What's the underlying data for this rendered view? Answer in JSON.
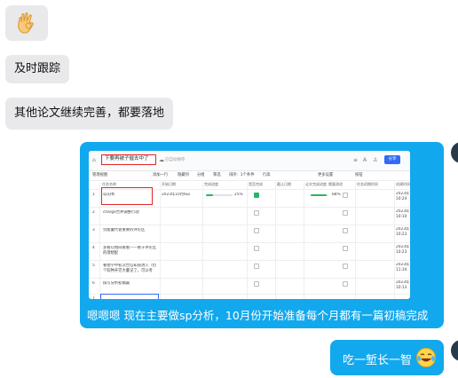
{
  "messages": {
    "incoming": [
      {
        "type": "emoji",
        "emoji": "ok-hand"
      },
      {
        "type": "text",
        "text": "及时跟踪"
      },
      {
        "type": "text",
        "text": "其他论文继续完善，都要落地"
      }
    ],
    "outgoing_caption": "嗯嗯嗯 现在主要做sp分析，10月份开始准备每个月都有一篇初稿完成",
    "outgoing_reply": "吃一堑长一智",
    "reply_emoji": "laughing-tears-face"
  },
  "embedded_screenshot": {
    "doc_title": "下要再被子催去中了",
    "saved_status": "已自动保存",
    "share_label": "分享",
    "toolbar": [
      "管理视图",
      "添加一行",
      "隐藏列",
      "分组",
      "筛选",
      "排序：1个条件",
      "行高",
      "更多设置",
      "按钮"
    ],
    "columns": [
      "任务名称",
      "开始日期",
      "完成进度",
      "是否完成",
      "截止日期",
      "论文完成进度",
      "需要改进",
      "任务初期时间",
      "创建时间"
    ],
    "rows": [
      {
        "num": "1",
        "task": "sp分析",
        "start": "2023年10月6日",
        "progress_pct": 25,
        "progress_label": "25%",
        "done": true,
        "paper_pct": 88,
        "paper_label": "88%",
        "created": "2023年\n10:24"
      },
      {
        "num": "2",
        "task": "charge合并调整行动",
        "start": "",
        "progress_pct": null,
        "progress_label": "",
        "done": false,
        "paper_pct": null,
        "paper_label": "",
        "created": "2023年\n10:10"
      },
      {
        "num": "3",
        "task": "负能量代管重要的评论区",
        "start": "",
        "progress_pct": null,
        "progress_label": "",
        "done": false,
        "paper_pct": null,
        "paper_label": "",
        "created": "2023年\n10:23"
      },
      {
        "num": "4",
        "task": "多看在相同看看——看于评论区的理想配",
        "start": "",
        "progress_pct": null,
        "progress_label": "",
        "done": false,
        "paper_pct": null,
        "paper_label": "",
        "created": "2023年\n10:23"
      },
      {
        "num": "5",
        "task": "看他学申初次合信知道进入（但个较种开完大量记了，可以考",
        "start": "",
        "progress_pct": null,
        "progress_label": "",
        "done": false,
        "paper_pct": null,
        "paper_label": "",
        "created": "2023年\n11:34"
      },
      {
        "num": "6",
        "task": "撰写分析初稿篇",
        "start": "",
        "progress_pct": null,
        "progress_label": "",
        "done": false,
        "paper_pct": null,
        "paper_label": "",
        "created": "2023年\n10:13"
      }
    ],
    "new_row_num": "7"
  },
  "colors": {
    "bubble_out": "#12a8ee",
    "bubble_in": "#e9e9eb",
    "highlight": "#e32626",
    "accent": "#2f6bf5",
    "progress": "#29b36a"
  }
}
